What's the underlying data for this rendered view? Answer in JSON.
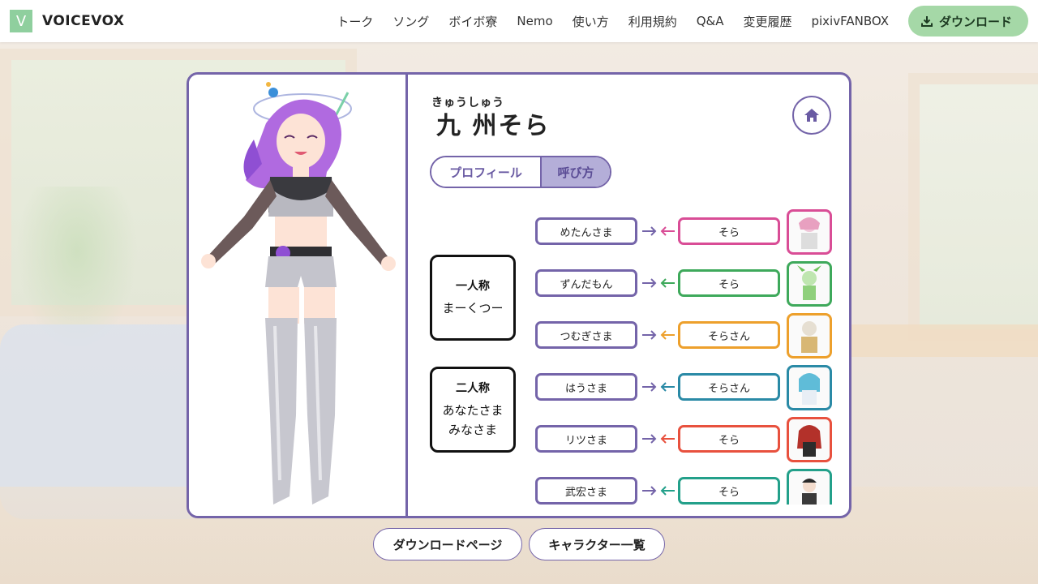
{
  "header": {
    "logo_letter": "V",
    "brand": "VOICEVOX",
    "nav": [
      "トーク",
      "ソング",
      "ボイボ寮",
      "Nemo",
      "使い方",
      "利用規約",
      "Q&A",
      "変更履歴",
      "pixivFANBOX"
    ],
    "download_label": "ダウンロード"
  },
  "character": {
    "ruby": "きゅうしゅう",
    "name": "九 州そら"
  },
  "tabs": {
    "profile": "プロフィール",
    "calls": "呼び方"
  },
  "pronouns": {
    "first": {
      "label": "一人称",
      "values": [
        "まーくつー"
      ]
    },
    "second": {
      "label": "二人称",
      "values": [
        "あなたさま",
        "みなさま"
      ]
    }
  },
  "calls": [
    {
      "to": "めたんさま",
      "from": "そら",
      "color": "#d94d96"
    },
    {
      "to": "ずんだもん",
      "from": "そら",
      "color": "#3ea95b"
    },
    {
      "to": "つむぎさま",
      "from": "そらさん",
      "color": "#eda02c"
    },
    {
      "to": "はうさま",
      "from": "そらさん",
      "color": "#2a8aa6"
    },
    {
      "to": "リツさま",
      "from": "そら",
      "color": "#e8513e"
    },
    {
      "to": "武宏さま",
      "from": "そら",
      "color": "#23a08a"
    }
  ],
  "bottom": {
    "download_page": "ダウンロードページ",
    "character_list": "キャラクター一覧"
  },
  "colors": {
    "accent": "#7464a9",
    "download_bg": "#a5d8a7",
    "logo_bg": "#8fcf9e"
  }
}
